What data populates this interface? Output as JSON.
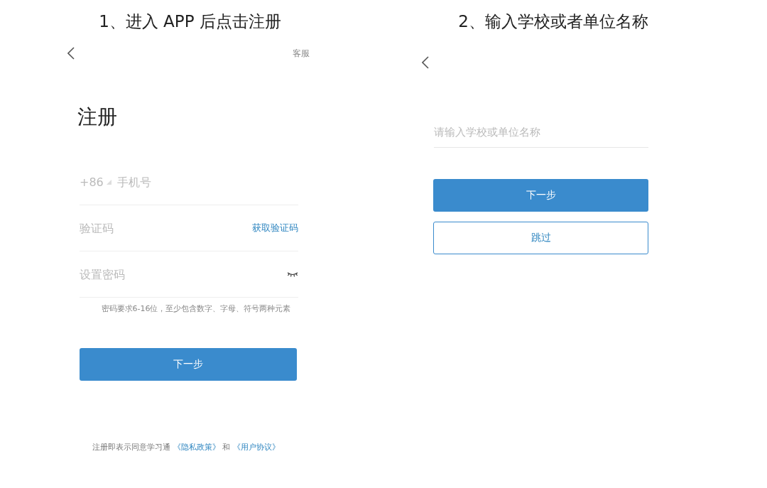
{
  "step1": {
    "caption": "1、进入 APP 后点击注册",
    "service_link": "客服",
    "title": "注册",
    "fields": [
      {
        "kind": "phone",
        "prefix": "+86",
        "placeholder": "手机号"
      },
      {
        "kind": "code",
        "placeholder": "验证码",
        "action": "获取验证码"
      },
      {
        "kind": "password",
        "placeholder": "设置密码"
      }
    ],
    "hint": "密码要求6-16位，至少包含数字、字母、符号两种元素",
    "next_button": "下一步",
    "agreement": {
      "text": "注册即表示同意学习通",
      "links": [
        "《隐私政策》",
        "《用户协议》"
      ],
      "joiner": "和"
    }
  },
  "step2": {
    "caption": "2、输入学校或者单位名称",
    "field": {
      "placeholder": "请输入学校或单位名称"
    },
    "buttons": [
      {
        "kind": "primary",
        "label": "下一步"
      },
      {
        "kind": "outline",
        "label": "跳过"
      }
    ]
  }
}
